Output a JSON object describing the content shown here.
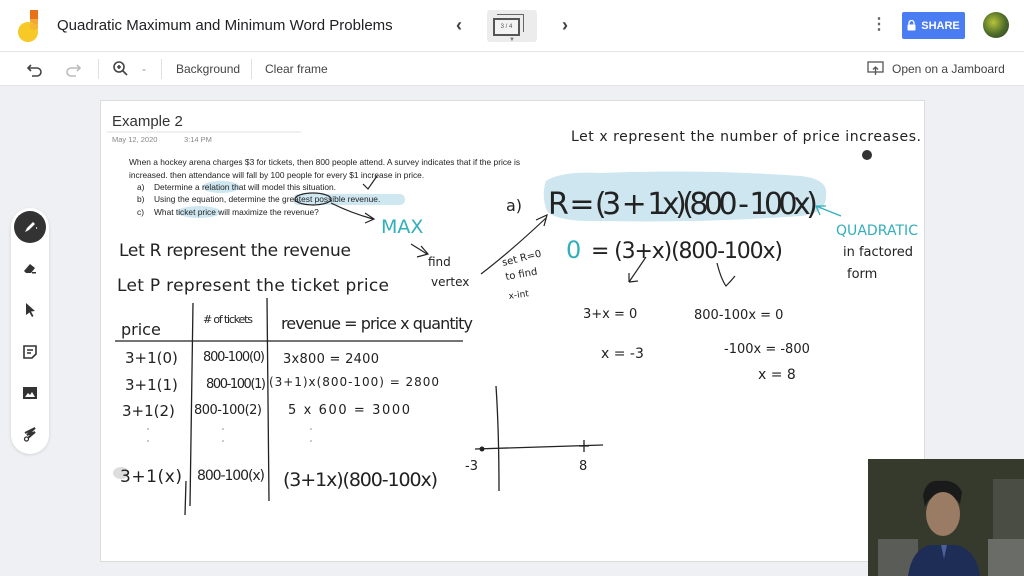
{
  "app": {
    "title": "Quadratic Maximum and Minimum Word Problems",
    "frame_indicator": "3 / 4",
    "share_label": "SHARE",
    "accent_color": "#4a7cf4"
  },
  "toolbar": {
    "background_label": "Background",
    "clear_frame_label": "Clear frame",
    "zoom_minus": "-",
    "open_jamboard_label": "Open on a Jamboard"
  },
  "side_tools": [
    "pen",
    "eraser",
    "select",
    "sticky-note",
    "image",
    "laser"
  ],
  "document": {
    "heading": "Example 2",
    "date": "May 12, 2020",
    "time": "3:14 PM",
    "problem_line1": "When a hockey arena charges $3 for tickets, then 800 people attend.  A survey indicates that if the price is",
    "problem_line2": "increased.  then attendance will fall by 100 people for every $1 increase in price.",
    "parts": [
      {
        "label": "a)",
        "text": "Determine a relation that will model this situation."
      },
      {
        "label": "b)",
        "text": "Using the equation, determine the greatest possible revenue."
      },
      {
        "label": "c)",
        "text": "What ticket price will maximize the revenue?"
      }
    ]
  },
  "handwriting": {
    "let_x": "Let  x  represent  the number of price increases.",
    "let_r": "Let R represent the revenue",
    "let_p": "Let P represent the ticket price",
    "max": "MAX",
    "find_vertex_1": "find",
    "find_vertex_2": "vertex",
    "set_r_1": "set R=0",
    "set_r_2": "to find",
    "set_r_3": "x-int",
    "part_a_label": "a)",
    "equation": "R = (3 + 1x)(800 - 100x)",
    "quadratic_1": "QUADRATIC",
    "quadratic_2": "in factored",
    "quadratic_3": "form",
    "zero_eq_zero": "0",
    "zero_eq_rest": "= (3+x)(800-100x)",
    "left_eq": "3+x = 0",
    "left_sol": "x = -3",
    "right_eq": "800-100x = 0",
    "right_step": "-100x = -800",
    "right_sol": "x = 8",
    "graph_left": "-3",
    "graph_right": "8"
  },
  "table": {
    "headers": [
      "price",
      "# of tickets",
      "revenue = price x quantity"
    ],
    "rows": [
      [
        "3+1(0)",
        "800-100(0)",
        "3x800 = 2400"
      ],
      [
        "3+1(1)",
        "800-100(1)",
        "(3+1)x(800-100) = 2800"
      ],
      [
        "3+1(2)",
        "800-100(2)",
        "5 x 600 = 3000"
      ],
      [
        "3+1(x)",
        "800-100(x)",
        "(3+1x)(800-100x)"
      ]
    ]
  }
}
